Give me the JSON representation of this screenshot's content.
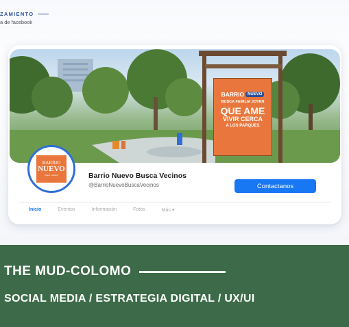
{
  "top_caption": {
    "line1": "ZAMIENTO",
    "line2": "a de facebook"
  },
  "sign": {
    "brand": "BARRIO",
    "brand_pill": "NUEVO",
    "line1": "BUSCA FAMILIA JOVEN",
    "big": "QUE AME",
    "mid1": "VIVIR CERCA",
    "small": "A LOS PARQUES"
  },
  "avatar": {
    "line1": "BARRIO",
    "line2": "NUEVO",
    "line3": "busca vecinos"
  },
  "page": {
    "name": "Barrio Nuevo Busca Vecinos",
    "handle": "@BarrioNuevoBuscaVecinos",
    "contact_label": "Contactanos"
  },
  "tabs": [
    {
      "label": "Inicio"
    },
    {
      "label": "Eventos"
    },
    {
      "label": "Información"
    },
    {
      "label": "Fotos"
    },
    {
      "label": "Más ▾"
    }
  ],
  "banner": {
    "title": "THE MUD-COLOMO",
    "subtitle": "SOCIAL MEDIA / ESTRATEGIA DIGITAL / UX/UI"
  },
  "colors": {
    "accent_blue": "#1877f2",
    "sign_orange": "#e9773d",
    "banner_green": "#3d6b49",
    "caption_blue": "#2a4d9a"
  }
}
